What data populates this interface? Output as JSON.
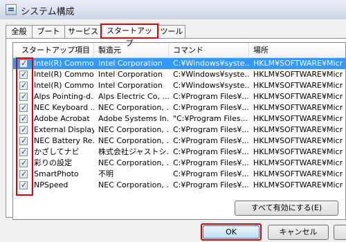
{
  "window": {
    "title": "システム構成"
  },
  "tabs": [
    {
      "label": "全般"
    },
    {
      "label": "ブート"
    },
    {
      "label": "サービス"
    },
    {
      "label": "スタートアップ",
      "active": true
    },
    {
      "label": "ツール"
    }
  ],
  "startup": {
    "columns": [
      "スタートアップ項目",
      "製造元",
      "コマンド",
      "場所"
    ],
    "rows": [
      {
        "item": "Intel(R) Commo...",
        "maker": "Intel Corporation",
        "command": "C:¥Windows¥syste...",
        "location": "HKLM¥SOFTWARE¥Micr",
        "checked": true,
        "selected": true
      },
      {
        "item": "Intel(R) Commo...",
        "maker": "Intel Corporation",
        "command": "C:¥Windows¥syste...",
        "location": "HKLM¥SOFTWARE¥Micr",
        "checked": true
      },
      {
        "item": "Intel(R) Commo...",
        "maker": "Intel Corporation",
        "command": "C:¥Windows¥syste...",
        "location": "HKLM¥SOFTWARE¥Micr",
        "checked": true
      },
      {
        "item": "Alps Pointing-d...",
        "maker": "Alps Electric Co, ...",
        "command": "C:¥Program Files¥...",
        "location": "HKLM¥SOFTWARE¥Micr",
        "checked": true
      },
      {
        "item": "NEC Keyboard ...",
        "maker": "NEC Corporation, ...",
        "command": "C:¥Program Files¥...",
        "location": "HKLM¥SOFTWARE¥Micr",
        "checked": true
      },
      {
        "item": "Adobe Acrobat",
        "maker": "Adobe Systems In...",
        "command": "\"C:¥Program Files...",
        "location": "HKLM¥SOFTWARE¥Micr",
        "checked": true
      },
      {
        "item": "External Display...",
        "maker": "NEC Corporation, ...",
        "command": "C:¥Program Files¥...",
        "location": "HKLM¥SOFTWARE¥Micr",
        "checked": true
      },
      {
        "item": "NEC Battery Re...",
        "maker": "NEC Corporation, ...",
        "command": "C:¥Program Files¥...",
        "location": "HKLM¥SOFTWARE¥Micr",
        "checked": true
      },
      {
        "item": "かざしてナビ",
        "maker": "株式会社ジャストシ...",
        "command": "C:¥Program Files¥...",
        "location": "HKLM¥SOFTWARE¥Micr",
        "checked": true
      },
      {
        "item": "彩りの設定",
        "maker": "NEC Corporation, ...",
        "command": "C:¥Program Files¥...",
        "location": "HKLM¥SOFTWARE¥Micr",
        "checked": true
      },
      {
        "item": "SmartPhoto",
        "maker": "不明",
        "command": "C:¥Program Files¥...",
        "location": "HKLM¥SOFTWARE¥Micr",
        "checked": true
      },
      {
        "item": "NPSpeed",
        "maker": "NEC Corporation, ...",
        "command": "C:¥Program Files¥...",
        "location": "HKLM¥SOFTWARE¥Micr",
        "checked": true
      }
    ]
  },
  "buttons": {
    "enable_all": "すべて有効にする(E)",
    "ok": "OK",
    "cancel": "キャンセル"
  },
  "colors": {
    "highlight": "#e10000",
    "selection": "#3399ff"
  }
}
